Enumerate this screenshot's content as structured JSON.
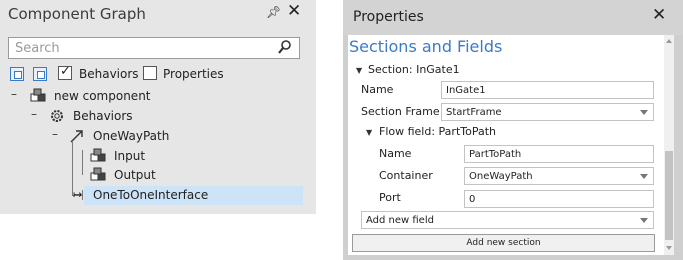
{
  "component_graph": {
    "title": "Component Graph",
    "search": {
      "placeholder": "Search"
    },
    "toolbar": {
      "behaviors_label": "Behaviors",
      "behaviors_checked": true,
      "properties_label": "Properties",
      "properties_checked": false
    },
    "tree": {
      "root": "new component",
      "behaviors": "Behaviors",
      "path": "OneWayPath",
      "input": "Input",
      "output": "Output",
      "interface": "OneToOneInterface"
    }
  },
  "properties": {
    "title": "Properties",
    "section_heading": "Sections and Fields",
    "section": {
      "header": "Section: InGate1",
      "name_label": "Name",
      "name_value": "InGate1",
      "frame_label": "Section Frame",
      "frame_value": "StartFrame"
    },
    "flow_field": {
      "header": "Flow field: PartToPath",
      "name_label": "Name",
      "name_value": "PartToPath",
      "container_label": "Container",
      "container_value": "OneWayPath",
      "port_label": "Port",
      "port_value": "0"
    },
    "add_field": "Add new field",
    "add_section": "Add new section"
  }
}
